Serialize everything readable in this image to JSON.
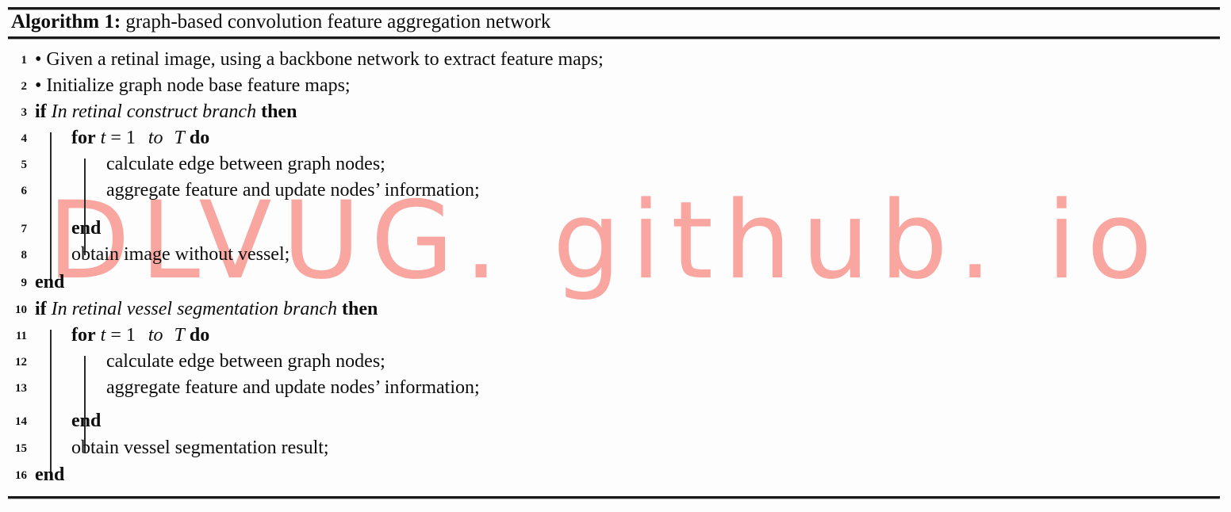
{
  "document": {
    "type": "algorithm-pseudocode",
    "title_label": "Algorithm 1:",
    "title_text": "graph-based convolution feature aggregation network"
  },
  "watermark": {
    "text": "DLVUG. github. io",
    "color": "#f9a6a0"
  },
  "lines": [
    {
      "n": "1",
      "indent": 0,
      "text": "• Given a retinal image, using a backbone network to extract feature maps;"
    },
    {
      "n": "2",
      "indent": 0,
      "text": "• Initialize graph node base feature maps;"
    },
    {
      "n": "3",
      "indent": 0,
      "kw1": "if",
      "cond": "In retinal construct branch",
      "kw2": "then"
    },
    {
      "n": "4",
      "indent": 1,
      "kw1": "for",
      "var": "t",
      "eq": "= 1",
      "to": "to",
      "bound": "T",
      "kw2": "do"
    },
    {
      "n": "5",
      "indent": 2,
      "text": "calculate edge between graph nodes;"
    },
    {
      "n": "6",
      "indent": 2,
      "text": "aggregate feature and update nodes’ information;"
    },
    {
      "n": "7",
      "indent": 1,
      "kw1": "end"
    },
    {
      "n": "8",
      "indent": 1,
      "text": "obtain image without vessel;"
    },
    {
      "n": "9",
      "indent": 0,
      "kw1": "end"
    },
    {
      "n": "10",
      "indent": 0,
      "kw1": "if",
      "cond": "In retinal vessel segmentation branch",
      "kw2": "then"
    },
    {
      "n": "11",
      "indent": 1,
      "kw1": "for",
      "var": "t",
      "eq": "= 1",
      "to": "to",
      "bound": "T",
      "kw2": "do"
    },
    {
      "n": "12",
      "indent": 2,
      "text": "calculate edge between graph nodes;"
    },
    {
      "n": "13",
      "indent": 2,
      "text": "aggregate feature and update nodes’ information;"
    },
    {
      "n": "14",
      "indent": 1,
      "kw1": "end"
    },
    {
      "n": "15",
      "indent": 1,
      "text": "obtain vessel segmentation result;"
    },
    {
      "n": "16",
      "indent": 0,
      "kw1": "end"
    }
  ]
}
